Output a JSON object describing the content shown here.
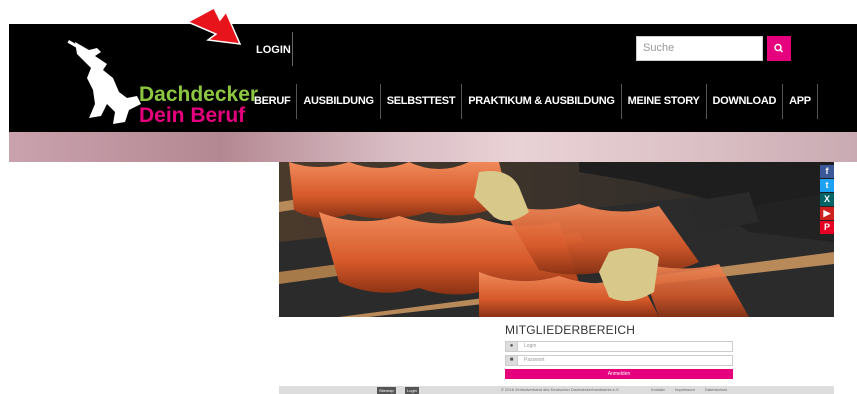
{
  "header": {
    "logo_line1": "Dachdecker",
    "logo_line2": "Dein Beruf",
    "login_label": "LOGIN",
    "search_placeholder": "Suche",
    "nav": [
      "BERUF",
      "AUSBILDUNG",
      "SELBSTTEST",
      "PRAKTIKUM & AUSBILDUNG",
      "MEINE STORY",
      "DOWNLOAD",
      "APP"
    ]
  },
  "social": {
    "icons": [
      "facebook-icon",
      "twitter-icon",
      "xing-icon",
      "youtube-icon",
      "pinterest-icon"
    ],
    "glyphs": [
      "f",
      "t",
      "X",
      "▶",
      "P"
    ]
  },
  "member": {
    "title": "MITGLIEDERBEREICH",
    "login_placeholder": "Login",
    "password_placeholder": "Passwort",
    "submit_label": "Anmelden"
  },
  "footer": {
    "btn1": "Sitemap",
    "btn2": "Login",
    "copyright": "© 2016 Zentralverband des Deutschen Dachdeckerhandwerks e.V.",
    "links": [
      "Kontakt",
      "Impressum",
      "Datenschutz"
    ]
  },
  "colors": {
    "accent": "#e6007e",
    "logo_green": "#8dc63f",
    "header_bg": "#000000"
  }
}
